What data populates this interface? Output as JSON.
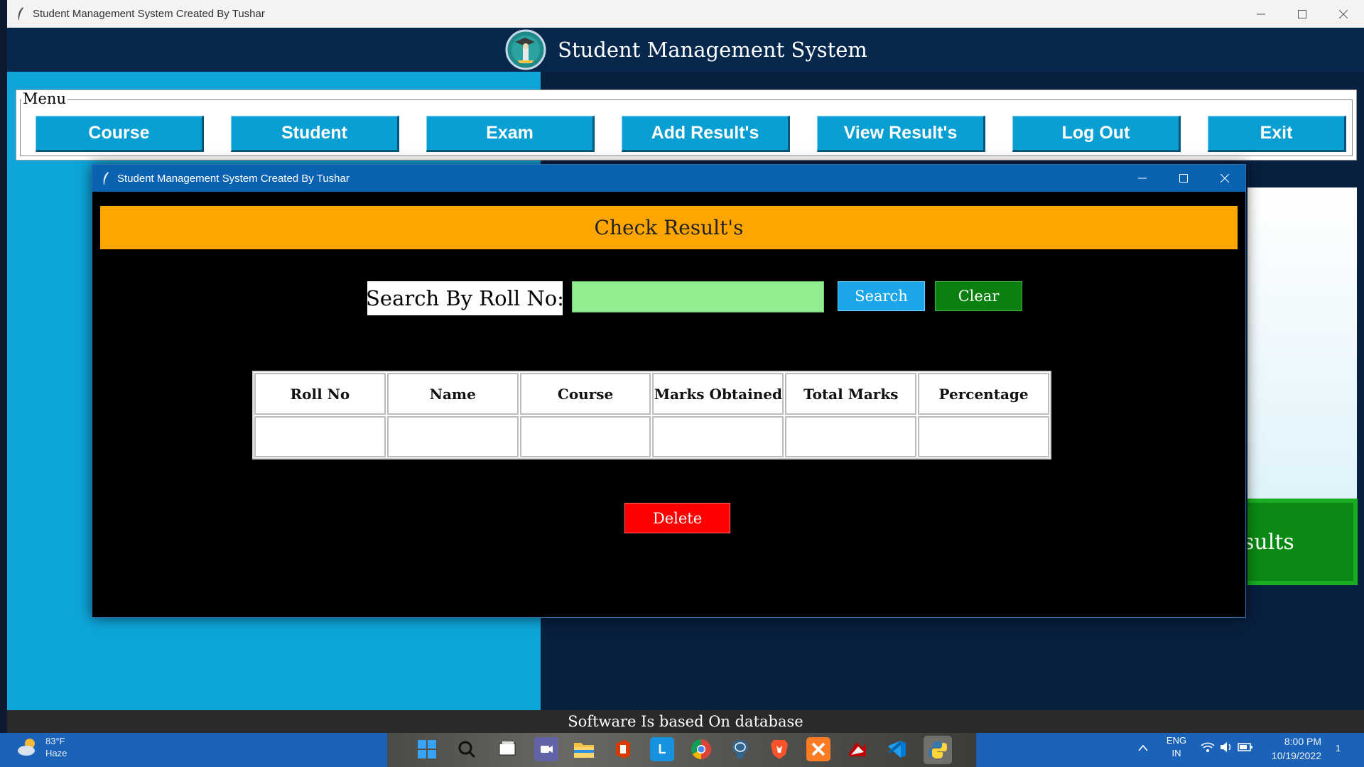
{
  "main_window": {
    "title": "Student Management System Created By Tushar",
    "app_title": "Student Management System",
    "menu_label": "Menu",
    "menu_buttons": [
      "Course",
      "Student",
      "Exam",
      "Add Result's",
      "View Result's",
      "Log Out",
      "Exit"
    ],
    "background_results_fragment": "sults",
    "footer_text": "Software Is based On database"
  },
  "child_window": {
    "title": "Student Management System Created By Tushar",
    "banner": "Check Result's",
    "search_label": "Search By Roll No:",
    "search_value": "",
    "search_button": "Search",
    "clear_button": "Clear",
    "table_headers": [
      "Roll No",
      "Name",
      "Course",
      "Marks Obtained",
      "Total Marks",
      "Percentage"
    ],
    "delete_button": "Delete"
  },
  "taskbar": {
    "weather_temp": "83°F",
    "weather_desc": "Haze",
    "language": "ENG",
    "region": "IN",
    "time": "8:00 PM",
    "date": "10/19/2022",
    "notification_count": "1",
    "icons": [
      "windows-start-icon",
      "search-icon",
      "task-view-icon",
      "teams-icon",
      "file-explorer-icon",
      "office-icon",
      "l-app-icon",
      "chrome-icon",
      "postgres-icon",
      "brave-icon",
      "xampp-icon",
      "filezilla-icon",
      "vscode-icon",
      "python-icon"
    ]
  },
  "colors": {
    "menu_button": "#0a9fd3",
    "banner": "#ffa500",
    "search_input": "#90ee90",
    "search_button": "#1ba6ea",
    "clear_button": "#0b8011",
    "delete_button": "#ff0000",
    "header": "#06284d"
  }
}
